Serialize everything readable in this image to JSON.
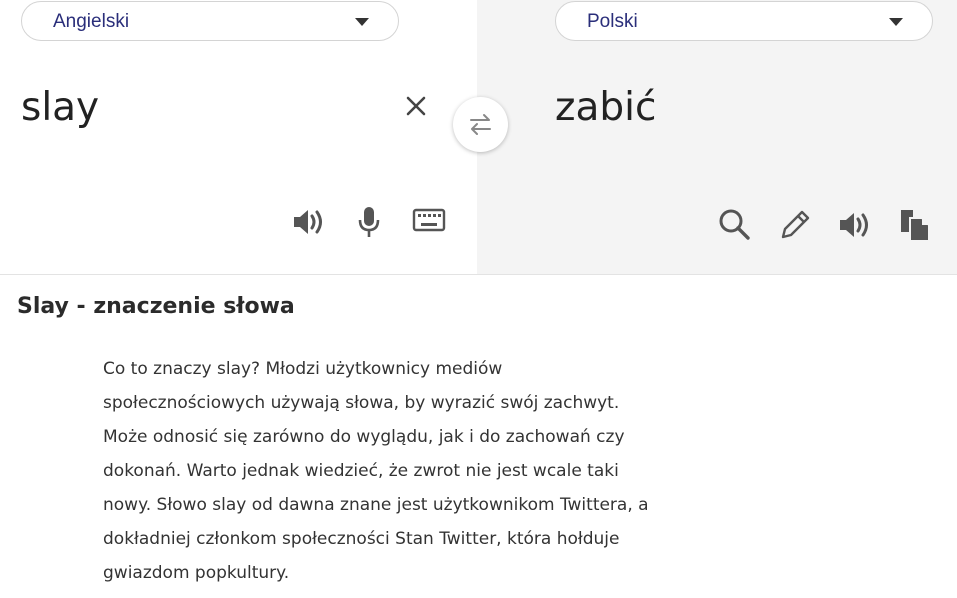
{
  "translator": {
    "source_language": "Angielski",
    "target_language": "Polski",
    "source_text": "slay",
    "target_text": "zabić",
    "icons": {
      "clear": "close-icon",
      "swap": "swap-arrows-icon",
      "source_speak": "speaker-icon",
      "microphone": "microphone-icon",
      "keyboard": "keyboard-icon",
      "search": "search-icon",
      "edit": "pencil-icon",
      "target_speak": "speaker-icon",
      "copy": "copy-icon"
    }
  },
  "article": {
    "heading": "Slay - znaczenie słowa",
    "lines": [
      "Co to znaczy slay? Młodzi użytkownicy mediów",
      "społecznościowych używają słowa, by wyrazić swój zachwyt.",
      "Może odnosić się zarówno do wyglądu, jak i do zachowań czy",
      "dokonań. Warto jednak wiedzieć, że zwrot nie jest wcale taki",
      "nowy. Słowo slay od dawna znane jest użytkownikom Twittera, a",
      "dokładniej członkom społeczności Stan Twitter, która hołduje",
      "gwiazdom popkultury."
    ]
  },
  "colors": {
    "language_text": "#2a2e7a",
    "target_pane_bg": "#f4f4f4",
    "icon_gray": "#555555"
  }
}
